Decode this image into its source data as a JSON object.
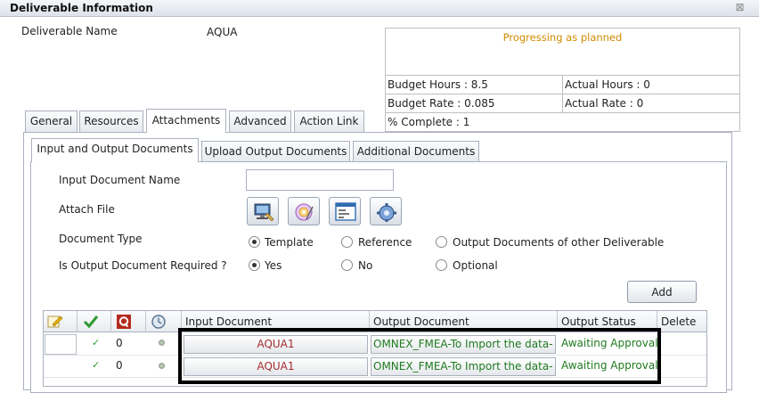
{
  "window": {
    "title": "Deliverable Information",
    "close_symbol": "⊠"
  },
  "deliverable": {
    "name_label": "Deliverable Name",
    "name_value": "AQUA"
  },
  "status": {
    "text": "Progressing as planned",
    "budget_hours": "Budget Hours : 8.5",
    "actual_hours": "Actual Hours : 0",
    "budget_rate": "Budget Rate : 0.085",
    "actual_rate": "Actual Rate : 0",
    "percent_complete": "% Complete : 1"
  },
  "tabs": [
    "General",
    "Resources",
    "Attachments",
    "Advanced",
    "Action Link"
  ],
  "active_tab": "Attachments",
  "subtabs": [
    "Input and Output Documents",
    "Upload Output Documents",
    "Additional Documents"
  ],
  "active_subtab": "Input and Output Documents",
  "form": {
    "input_doc_label": "Input Document Name",
    "input_doc_value": "",
    "attach_file_label": "Attach File",
    "doc_type_label": "Document Type",
    "doc_type_options": [
      "Template",
      "Reference",
      "Output Documents of other Deliverable"
    ],
    "doc_type_selected": "Template",
    "output_required_label": "Is Output Document Required ?",
    "output_required_options": [
      "Yes",
      "No",
      "Optional"
    ],
    "output_required_selected": "Yes",
    "add_button": "Add"
  },
  "grid": {
    "columns": [
      "",
      "",
      "",
      "",
      "Input Document",
      "Output Document",
      "Output Status",
      "Delete"
    ],
    "header_icons": [
      "edit-icon",
      "check-icon",
      "q-icon",
      "history-icon"
    ],
    "rows": [
      {
        "check": "✓",
        "count": "0",
        "input_doc": "AQUA1",
        "output_doc": "OMNEX_FMEA-To Import the data-",
        "status": "Awaiting Approval"
      },
      {
        "check": "✓",
        "count": "0",
        "input_doc": "AQUA1",
        "output_doc": "OMNEX_FMEA-To Import the data-",
        "status": "Awaiting Approval"
      }
    ]
  },
  "colors": {
    "status_text": "#d08a00",
    "link_green": "#1f7a1f",
    "input_doc_red": "#a42d2d",
    "q_icon_bg": "#b32a1e"
  }
}
